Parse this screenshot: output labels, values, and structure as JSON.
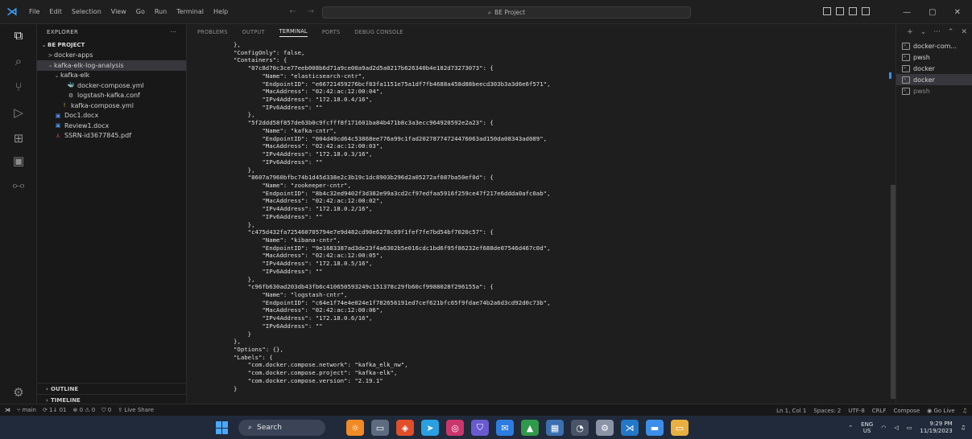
{
  "titlebar": {
    "menu": [
      "File",
      "Edit",
      "Selection",
      "View",
      "Go",
      "Run",
      "Terminal",
      "Help"
    ],
    "search_text": "BE Project"
  },
  "sidebar": {
    "header": "EXPLORER",
    "more": "···",
    "items": [
      {
        "label": "BE PROJECT",
        "depth": 0,
        "chevron": "⌄",
        "icon": "",
        "bold": true
      },
      {
        "label": "docker-apps",
        "depth": 1,
        "chevron": ">",
        "icon": ""
      },
      {
        "label": "kafka-elk-log-analysis",
        "depth": 1,
        "chevron": "⌄",
        "icon": "",
        "selected": true
      },
      {
        "label": "kafka-elk",
        "depth": 2,
        "chevron": "⌄",
        "icon": ""
      },
      {
        "label": "docker-compose.yml",
        "depth": 3,
        "chevron": "",
        "icon": "🐳",
        "icon_color": "#e04a5f"
      },
      {
        "label": "logstash-kafka.conf",
        "depth": 3,
        "chevron": "",
        "icon": "⚙",
        "icon_color": "#c0c0c0"
      },
      {
        "label": "kafka-compose.yml",
        "depth": 2,
        "chevron": "",
        "icon": "!",
        "icon_color": "#e8b84a"
      },
      {
        "label": "Doc1.docx",
        "depth": 1,
        "chevron": "",
        "icon": "▣",
        "icon_color": "#4b8fe0"
      },
      {
        "label": "Review1.docx",
        "depth": 1,
        "chevron": "",
        "icon": "▣",
        "icon_color": "#4b8fe0"
      },
      {
        "label": "SSRN-id3677845.pdf",
        "depth": 1,
        "chevron": "",
        "icon": "⅄",
        "icon_color": "#e05050"
      }
    ],
    "outline": "OUTLINE",
    "timeline": "TIMELINE"
  },
  "panel": {
    "tabs": [
      "PROBLEMS",
      "OUTPUT",
      "TERMINAL",
      "PORTS",
      "DEBUG CONSOLE"
    ],
    "active_tab": "TERMINAL"
  },
  "terminal_lines": [
    "},",
    "\"ConfigOnly\": false,",
    "\"Containers\": {",
    "    \"07c8d70c3ce77eeb008b6d71a9ce00a9ad2d5a0217b626340b4e182d73273073\": {",
    "        \"Name\": \"elasticsearch-cntr\",",
    "        \"EndpointID\": \"e66721459276bcf83fa1151e75a1df7fb4688a458d88beecd303b3a3d6e6f571\",",
    "        \"MacAddress\": \"02:42:ac:12:00:04\",",
    "        \"IPv4Address\": \"172.18.0.4/16\",",
    "        \"IPv6Address\": \"\"",
    "    },",
    "    \"5f2ddd58f857de63b0c9fcfff8f171601ba84b471b8c3a3ecc964920592e2a23\": {",
    "        \"Name\": \"kafka-cntr\",",
    "        \"EndpointID\": \"004d49cd64c53868ee776a99c1fad20278774724476063ad150da08343ad089\",",
    "        \"MacAddress\": \"02:42:ac:12:00:03\",",
    "        \"IPv4Address\": \"172.18.0.3/16\",",
    "        \"IPv6Address\": \"\"",
    "    },",
    "    \"8607a7960bfbc74b1d45d338e2c3b19c1dc8903b296d2a05272af087ba50ef0d\": {",
    "        \"Name\": \"zookeeper-cntr\",",
    "        \"EndpointID\": \"8b4c32ed9402f3d382e99a3cd2cf97edfaa5916f259ce47f217e6ddda0afc0ab\",",
    "        \"MacAddress\": \"02:42:ac:12:00:02\",",
    "        \"IPv4Address\": \"172.18.0.2/16\",",
    "        \"IPv6Address\": \"\"",
    "    },",
    "    \"c475d432fa725460705794e7e9d482cd90e6278c69f1fef7fe7bd54bf7020c57\": {",
    "        \"Name\": \"kibana-cntr\",",
    "        \"EndpointID\": \"9e1683387ad3de23f4a6302b5e016cdc1bd6f95f86232ef688de07546d467c0d\",",
    "        \"MacAddress\": \"02:42:ac:12:00:05\",",
    "        \"IPv4Address\": \"172.18.0.5/16\",",
    "        \"IPv6Address\": \"\"",
    "    },",
    "    \"c96fb630ad203db43fb6c410650593249c151378c29fb60cf9988028f296155a\": {",
    "        \"Name\": \"logstash-cntr\",",
    "        \"EndpointID\": \"c64e1f74e4e024e1f782656191ed7cef621bfc65f9fdae74b2a6d3cd92d0c73b\",",
    "        \"MacAddress\": \"02:42:ac:12:00:06\",",
    "        \"IPv4Address\": \"172.18.0.6/16\",",
    "        \"IPv6Address\": \"\"",
    "    }",
    "},",
    "\"Options\": {},",
    "\"Labels\": {",
    "    \"com.docker.compose.network\": \"kafka_elk_nw\",",
    "    \"com.docker.compose.project\": \"kafka-elk\",",
    "    \"com.docker.compose.version\": \"2.19.1\"",
    "}"
  ],
  "terminal_list": [
    {
      "label": "docker-com...",
      "active": false,
      "dim": false
    },
    {
      "label": "pwsh",
      "active": false,
      "dim": false
    },
    {
      "label": "docker",
      "active": false,
      "dim": false
    },
    {
      "label": "docker",
      "active": true,
      "dim": false
    },
    {
      "label": "pwsh",
      "active": false,
      "dim": true
    }
  ],
  "statusbar": {
    "branch": "main",
    "sync": "1↓ 01",
    "errors": "0",
    "warnings": "0",
    "ports": "0",
    "live_share": "Live Share",
    "position": "Ln 1, Col 1",
    "spaces": "Spaces: 2",
    "encoding": "UTF-8",
    "eol": "CRLF",
    "language": "Compose",
    "go_live": "Go Live"
  },
  "taskbar": {
    "search": "Search",
    "lang_top": "ENG",
    "lang_bottom": "US",
    "time": "9:29 PM",
    "date": "11/19/2023"
  },
  "colors": {
    "accent": "#3b8eea",
    "background": "#1e1e1e",
    "taskbar": "#202a3a"
  }
}
